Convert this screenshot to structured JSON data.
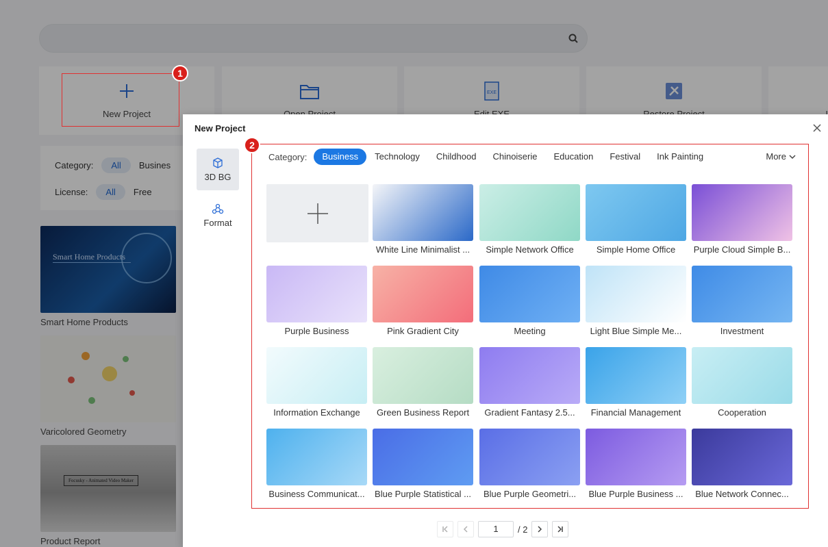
{
  "background": {
    "search": {
      "placeholder": ""
    },
    "tiles": [
      {
        "label": "New Project",
        "icon": "plus-icon"
      },
      {
        "label": "Open Project",
        "icon": "folder-icon"
      },
      {
        "label": "Edit EXE",
        "icon": "exe-file-icon"
      },
      {
        "label": "Restore Project",
        "icon": "restore-tools-icon"
      },
      {
        "label": "I",
        "icon": "more-tile-icon"
      }
    ],
    "filters": {
      "category_label": "Category:",
      "category_all": "All",
      "category_business": "Busines",
      "license_label": "License:",
      "license_all": "All",
      "license_free": "Free"
    },
    "templates": [
      {
        "title": "Smart Home Products",
        "img_text": "Smart Home Products"
      },
      {
        "title": "Varicolored Geometry"
      },
      {
        "title": "Product Report",
        "img_text": "Focusky - Animated Video Maker"
      }
    ]
  },
  "annotations": {
    "badge1": "1",
    "badge2": "2",
    "color": "#d9201b"
  },
  "modal": {
    "title": "New Project",
    "side": [
      {
        "label": "3D BG",
        "icon": "cube-icon",
        "active": true
      },
      {
        "label": "Format",
        "icon": "format-nodes-icon",
        "active": false
      }
    ],
    "category_label": "Category:",
    "categories": [
      "Business",
      "Technology",
      "Childhood",
      "Chinoiserie",
      "Education",
      "Festival",
      "Ink Painting"
    ],
    "active_category": "Business",
    "more_label": "More",
    "cards": [
      {
        "title": "White Line Minimalist ...",
        "c1": "#f4f5f8",
        "c2": "#2b69c8"
      },
      {
        "title": "Simple Network Office",
        "c1": "#cbeee6",
        "c2": "#8fd8c6"
      },
      {
        "title": "Simple Home Office",
        "c1": "#7ec8f0",
        "c2": "#4ea7e4"
      },
      {
        "title": "Purple Cloud Simple B...",
        "c1": "#7a4fd6",
        "c2": "#f0c2e5"
      },
      {
        "title": "Purple Business",
        "c1": "#c9b8f5",
        "c2": "#e9e2fb"
      },
      {
        "title": "Pink Gradient City",
        "c1": "#f7b2a6",
        "c2": "#f36d7a"
      },
      {
        "title": "Meeting",
        "c1": "#3f8ae6",
        "c2": "#6fb0f4"
      },
      {
        "title": "Light Blue Simple Me...",
        "c1": "#bfe3f7",
        "c2": "#ffffff"
      },
      {
        "title": "Investment",
        "c1": "#3f8be6",
        "c2": "#76b6f2"
      },
      {
        "title": "Information Exchange",
        "c1": "#f2fbfd",
        "c2": "#c7eef4"
      },
      {
        "title": "Green Business Report",
        "c1": "#d9efdf",
        "c2": "#b5dcc4"
      },
      {
        "title": "Gradient Fantasy 2.5...",
        "c1": "#8e7cf0",
        "c2": "#b9abf7"
      },
      {
        "title": "Financial Management",
        "c1": "#3aa3e9",
        "c2": "#8fd0f6"
      },
      {
        "title": "Cooperation",
        "c1": "#c8eef4",
        "c2": "#9adbe8"
      },
      {
        "title": "Business Communicat...",
        "c1": "#4eb1ee",
        "c2": "#a8d9f7"
      },
      {
        "title": "Blue Purple Statistical ...",
        "c1": "#4a6de6",
        "c2": "#5f9cf2"
      },
      {
        "title": "Blue Purple Geometri...",
        "c1": "#5a6ee6",
        "c2": "#8ba0f2"
      },
      {
        "title": "Blue Purple Business ...",
        "c1": "#7c5be0",
        "c2": "#b69cf2"
      },
      {
        "title": "Blue Network Connec...",
        "c1": "#3b3a9c",
        "c2": "#6a68d8"
      }
    ],
    "pager": {
      "current": "1",
      "total": "/ 2"
    }
  }
}
